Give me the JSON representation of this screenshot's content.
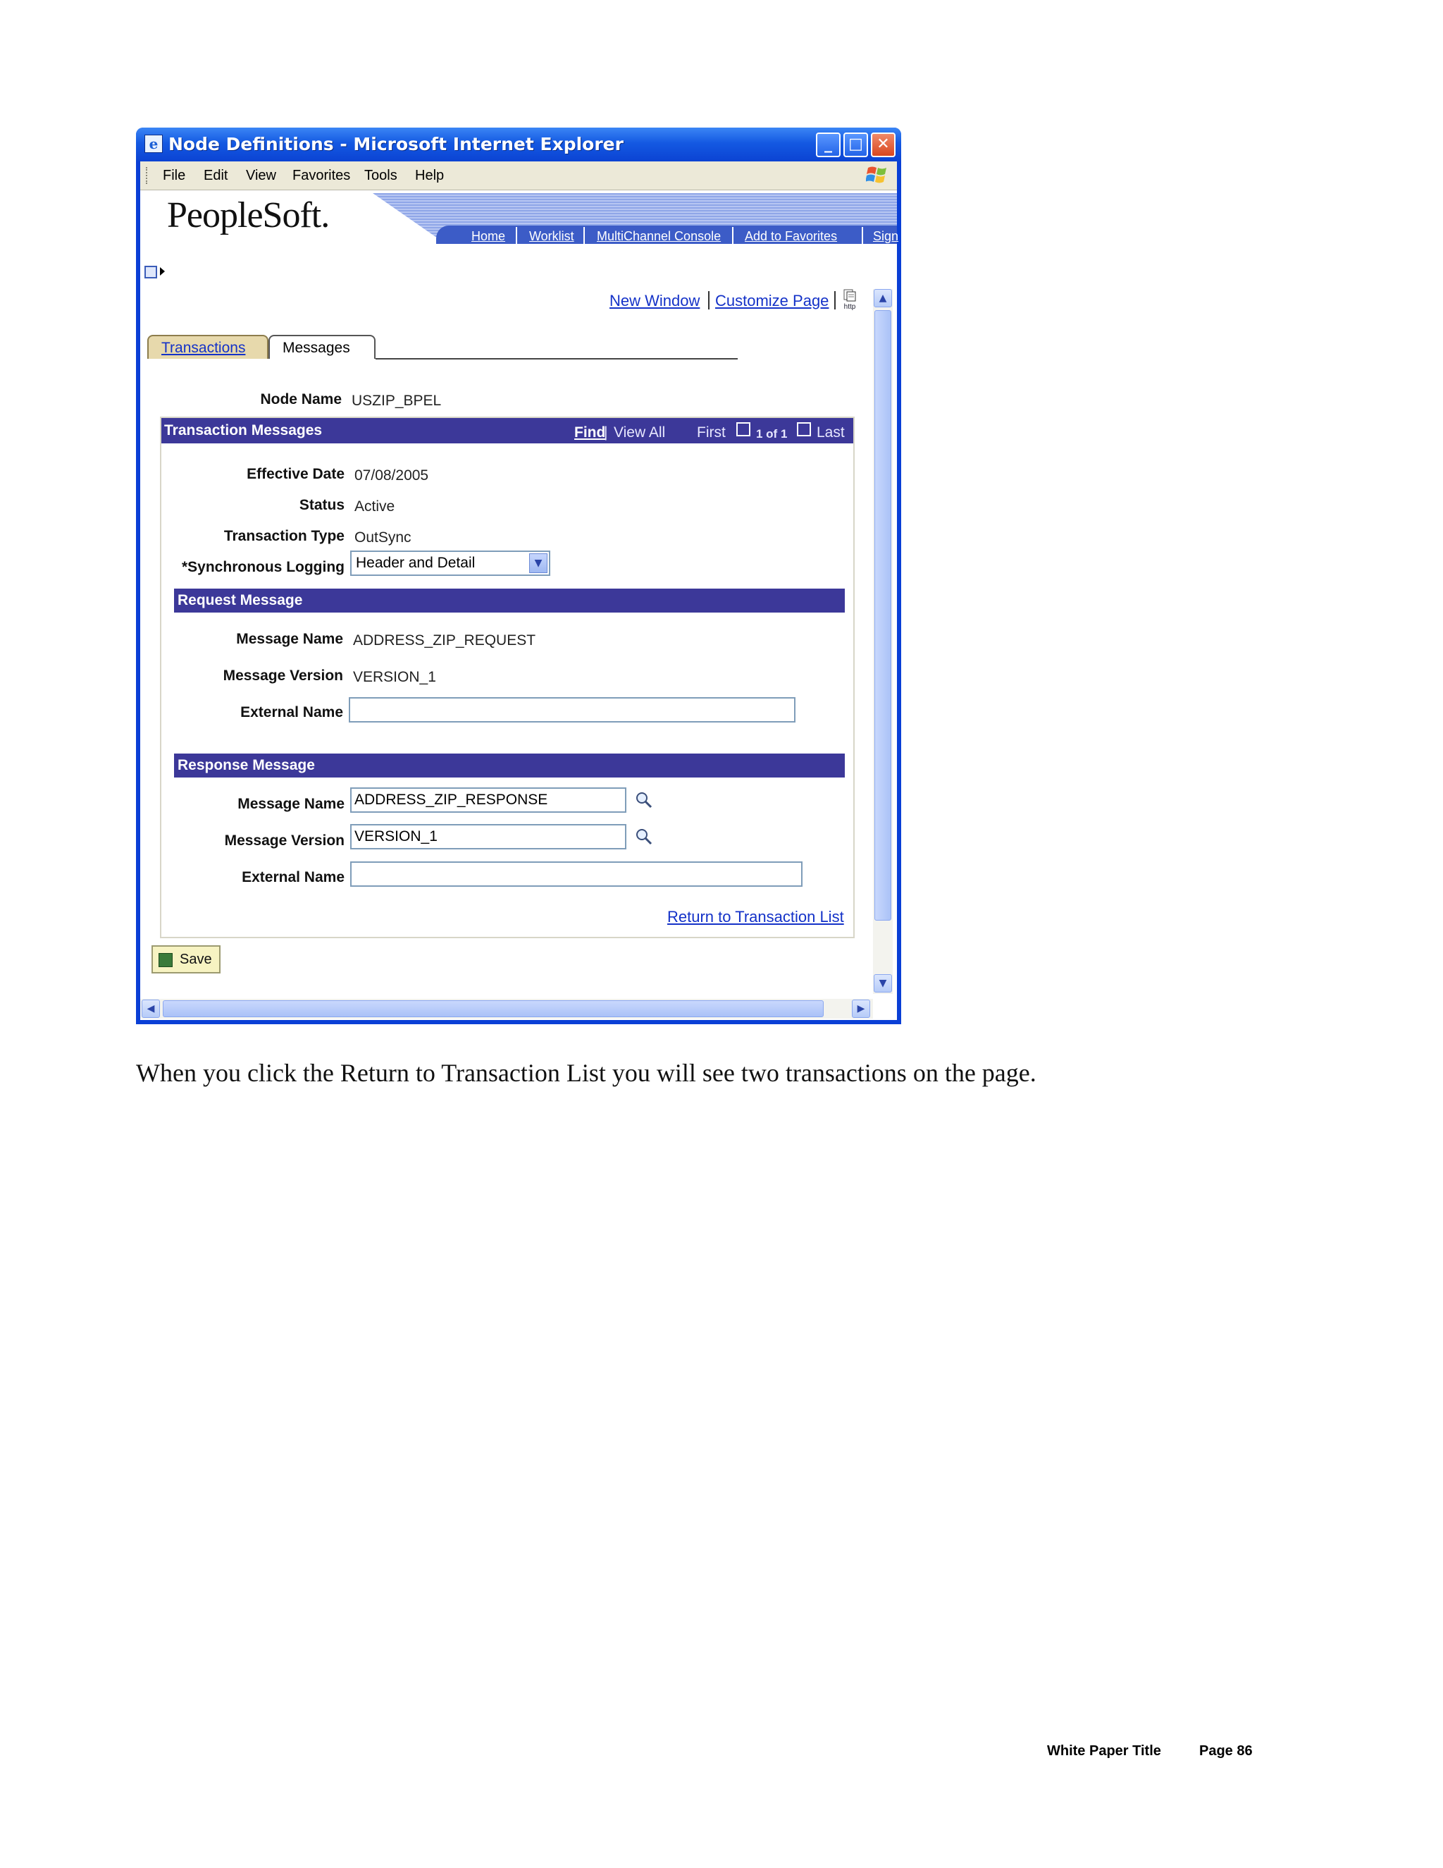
{
  "window": {
    "title": "Node Definitions - Microsoft Internet Explorer",
    "menu": [
      "File",
      "Edit",
      "View",
      "Favorites",
      "Tools",
      "Help"
    ]
  },
  "header": {
    "logo": "PeopleSoft.",
    "nav": [
      "Home",
      "Worklist",
      "MultiChannel Console",
      "Add to Favorites",
      "Sign"
    ]
  },
  "page_links": {
    "new_window": "New Window",
    "customize_page": "Customize Page",
    "http_icon": "http"
  },
  "tabs": [
    {
      "label": "Transactions",
      "active": false
    },
    {
      "label": "Messages",
      "active": true
    }
  ],
  "node": {
    "label": "Node Name",
    "value": "USZIP_BPEL"
  },
  "grid": {
    "title": "Transaction Messages",
    "find": "Find",
    "sep": "|",
    "view_all": "View All",
    "first": "First",
    "count": "1 of 1",
    "last": "Last"
  },
  "transaction": {
    "effective_date_label": "Effective Date",
    "effective_date": "07/08/2005",
    "status_label": "Status",
    "status": "Active",
    "type_label": "Transaction Type",
    "type": "OutSync",
    "logging_label": "*Synchronous Logging",
    "logging": "Header and Detail"
  },
  "request": {
    "title": "Request Message",
    "name_label": "Message Name",
    "name": "ADDRESS_ZIP_REQUEST",
    "version_label": "Message Version",
    "version": "VERSION_1",
    "external_label": "External Name",
    "external": ""
  },
  "response": {
    "title": "Response Message",
    "name_label": "Message Name",
    "name": "ADDRESS_ZIP_RESPONSE",
    "version_label": "Message Version",
    "version": "VERSION_1",
    "external_label": "External Name",
    "external": ""
  },
  "return_link": "Return to Transaction List",
  "save_label": "Save",
  "document": {
    "caption": "When you click the Return to Transaction List you will see two transactions on the page.",
    "footer_title": "White Paper Title",
    "footer_page": "Page 86"
  },
  "colors": {
    "section_bar": "#3c3899",
    "title_bar": "#0b43d3",
    "link": "#1432c8"
  }
}
